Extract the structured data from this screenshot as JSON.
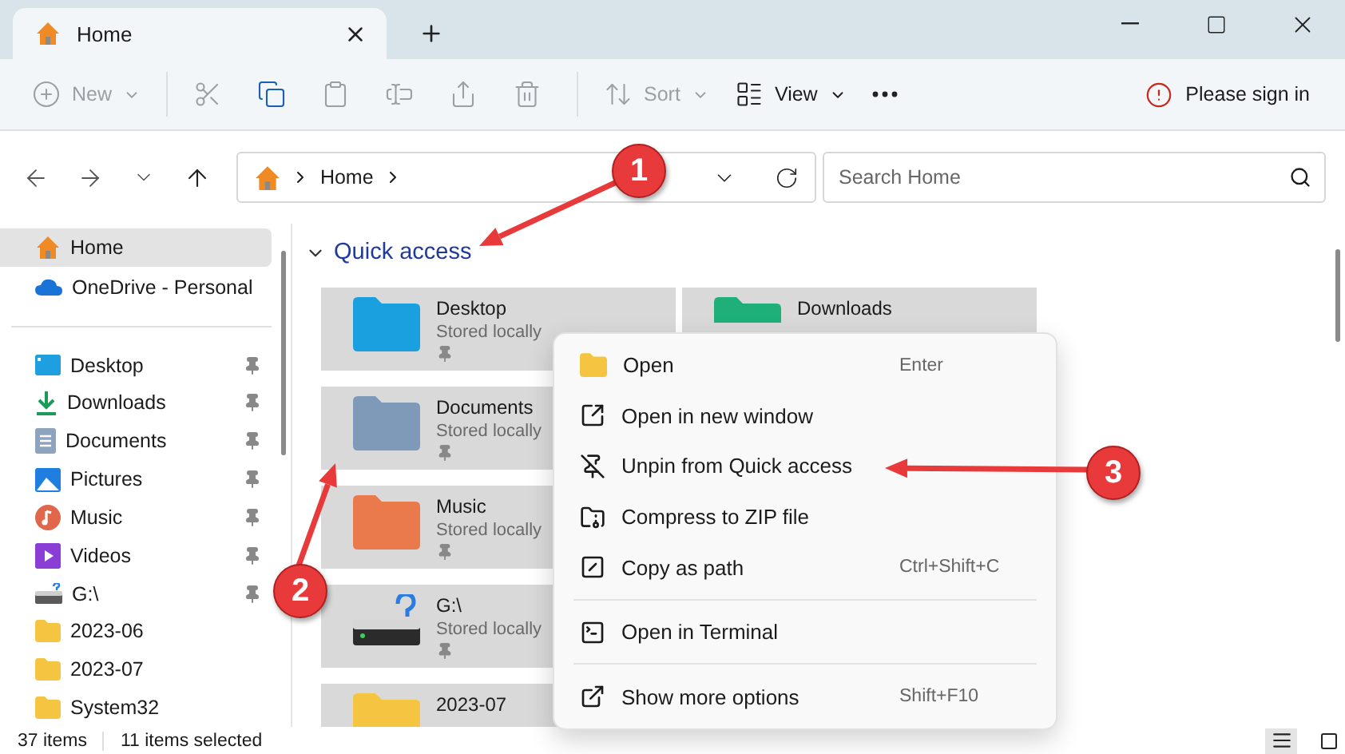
{
  "tab": {
    "title": "Home"
  },
  "toolbar": {
    "groups": [
      [
        {
          "label": "New",
          "disabled": true,
          "dropdown": true
        }
      ],
      [
        {
          "disabled": true,
          "dropdown": false
        },
        {
          "disabled": false,
          "dropdown": false
        },
        {
          "disabled": true,
          "dropdown": false
        },
        {
          "disabled": true,
          "dropdown": false
        },
        {
          "disabled": true,
          "dropdown": false
        },
        {
          "disabled": true,
          "dropdown": false
        }
      ],
      [
        {
          "label": "Sort",
          "disabled": true,
          "dropdown": true
        },
        {
          "label": "View",
          "disabled": false,
          "dropdown": true
        },
        {
          "disabled": false,
          "dropdown": false
        }
      ]
    ],
    "sign_in": "Please sign in"
  },
  "address": {
    "path": [
      "Home"
    ]
  },
  "search": {
    "placeholder": "Search Home"
  },
  "sidebar": {
    "top": [
      {
        "label": "Home",
        "selected": true
      },
      {
        "label": "OneDrive - Personal",
        "selected": false
      }
    ],
    "items": [
      {
        "label": "Desktop",
        "pinned": true
      },
      {
        "label": "Downloads",
        "pinned": true
      },
      {
        "label": "Documents",
        "pinned": true
      },
      {
        "label": "Pictures",
        "pinned": true
      },
      {
        "label": "Music",
        "pinned": true
      },
      {
        "label": "Videos",
        "pinned": true
      },
      {
        "label": "G:\\",
        "pinned": true
      },
      {
        "label": "2023-06",
        "pinned": false
      },
      {
        "label": "2023-07",
        "pinned": false
      },
      {
        "label": "System32",
        "pinned": false
      }
    ]
  },
  "quick_access": {
    "title": "Quick access",
    "expanded": true,
    "columns": [
      [
        {
          "name": "Desktop",
          "detail": "Stored locally",
          "pinned": true
        },
        {
          "name": "Documents",
          "detail": "Stored locally",
          "pinned": true
        },
        {
          "name": "Music",
          "detail": "Stored locally",
          "pinned": true
        },
        {
          "name": "G:\\",
          "detail": "Stored locally",
          "pinned": true
        },
        {
          "name": "2023-07"
        }
      ],
      [
        {
          "name": "Downloads"
        }
      ]
    ]
  },
  "context_menu": {
    "groups": [
      [
        {
          "label": "Open",
          "shortcut": "Enter"
        },
        {
          "label": "Open in new window"
        },
        {
          "label": "Unpin from Quick access"
        },
        {
          "label": "Compress to ZIP file"
        },
        {
          "label": "Copy as path",
          "shortcut": "Ctrl+Shift+C"
        }
      ],
      [
        {
          "label": "Open in Terminal"
        }
      ],
      [
        {
          "label": "Show more options",
          "shortcut": "Shift+F10"
        }
      ]
    ]
  },
  "annotations": [
    {
      "number": "1"
    },
    {
      "number": "2"
    },
    {
      "number": "3"
    }
  ],
  "status_bar": {
    "count": "37 items",
    "selection": "11 items selected",
    "views": [
      {
        "selected": true
      },
      {
        "selected": false
      }
    ]
  }
}
